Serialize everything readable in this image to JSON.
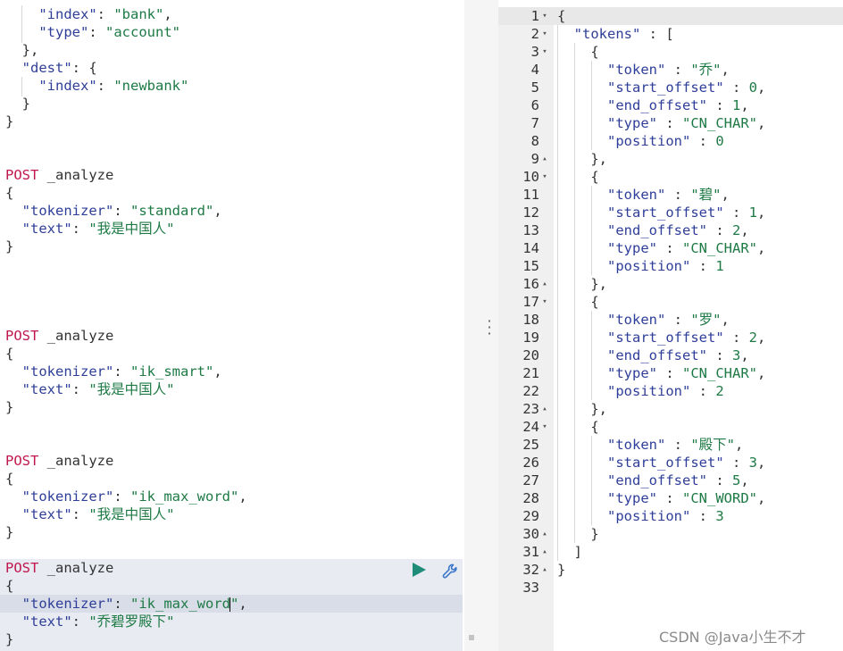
{
  "left": {
    "lines": {
      "l1": [
        "\"index\"",
        ": ",
        "\"bank\"",
        ","
      ],
      "l2": [
        "\"type\"",
        ": ",
        "\"account\""
      ],
      "l3": "},",
      "l4a": "\"dest\"",
      "l4b": ": {",
      "l5": [
        "\"index\"",
        ": ",
        "\"newbank\""
      ],
      "l6": "}",
      "l7": "}"
    },
    "requests": [
      {
        "method": "POST",
        "path": " _analyze",
        "open": "{",
        "tokenizer_key": "\"tokenizer\"",
        "tokenizer_val": "\"standard\"",
        "text_key": "\"text\"",
        "text_val": "\"我是中国人\"",
        "close": "}"
      },
      {
        "method": "POST",
        "path": " _analyze",
        "open": "{",
        "tokenizer_key": "\"tokenizer\"",
        "tokenizer_val": "\"ik_smart\"",
        "text_key": "\"text\"",
        "text_val": "\"我是中国人\"",
        "close": "}"
      },
      {
        "method": "POST",
        "path": " _analyze",
        "open": "{",
        "tokenizer_key": "\"tokenizer\"",
        "tokenizer_val": "\"ik_max_word\"",
        "text_key": "\"text\"",
        "text_val": "\"我是中国人\"",
        "close": "}"
      },
      {
        "method": "POST",
        "path": " _analyze",
        "open": "{",
        "tokenizer_key": "\"tokenizer\"",
        "tokenizer_val": "\"ik_max_word",
        "tokenizer_val_end": "\"",
        "text_key": "\"text\"",
        "text_val": "\"乔碧罗殿下\"",
        "close": "}"
      }
    ],
    "colon": ": ",
    "comma": ","
  },
  "response": {
    "line_numbers": [
      "1",
      "2",
      "3",
      "4",
      "5",
      "6",
      "7",
      "8",
      "9",
      "10",
      "11",
      "12",
      "13",
      "14",
      "15",
      "16",
      "17",
      "18",
      "19",
      "20",
      "21",
      "22",
      "23",
      "24",
      "25",
      "26",
      "27",
      "28",
      "29",
      "30",
      "31",
      "32",
      "33"
    ],
    "fold_down": "▾",
    "fold_up": "▴",
    "open_brace": "{",
    "tokens_key": "\"tokens\"",
    "tokens_sep": " : [",
    "close_bracket": "]",
    "close_brace": "}",
    "entry_open": "{",
    "entry_close": "},",
    "entry_close_last": "}",
    "sep": " : ",
    "comma": ",",
    "keys": {
      "token": "\"token\"",
      "start_offset": "\"start_offset\"",
      "end_offset": "\"end_offset\"",
      "type": "\"type\"",
      "position": "\"position\""
    },
    "tokens": [
      {
        "token": "\"乔\"",
        "start_offset": "0",
        "end_offset": "1",
        "type": "\"CN_CHAR\"",
        "position": "0"
      },
      {
        "token": "\"碧\"",
        "start_offset": "1",
        "end_offset": "2",
        "type": "\"CN_CHAR\"",
        "position": "1"
      },
      {
        "token": "\"罗\"",
        "start_offset": "2",
        "end_offset": "3",
        "type": "\"CN_CHAR\"",
        "position": "2"
      },
      {
        "token": "\"殿下\"",
        "start_offset": "3",
        "end_offset": "5",
        "type": "\"CN_WORD\"",
        "position": "3"
      }
    ]
  },
  "watermark": "CSDN @Java小生不才",
  "colors": {
    "accent": "#1f8c7a",
    "method": "#c0184e",
    "key": "#2f3f99",
    "string": "#1e7a45"
  }
}
